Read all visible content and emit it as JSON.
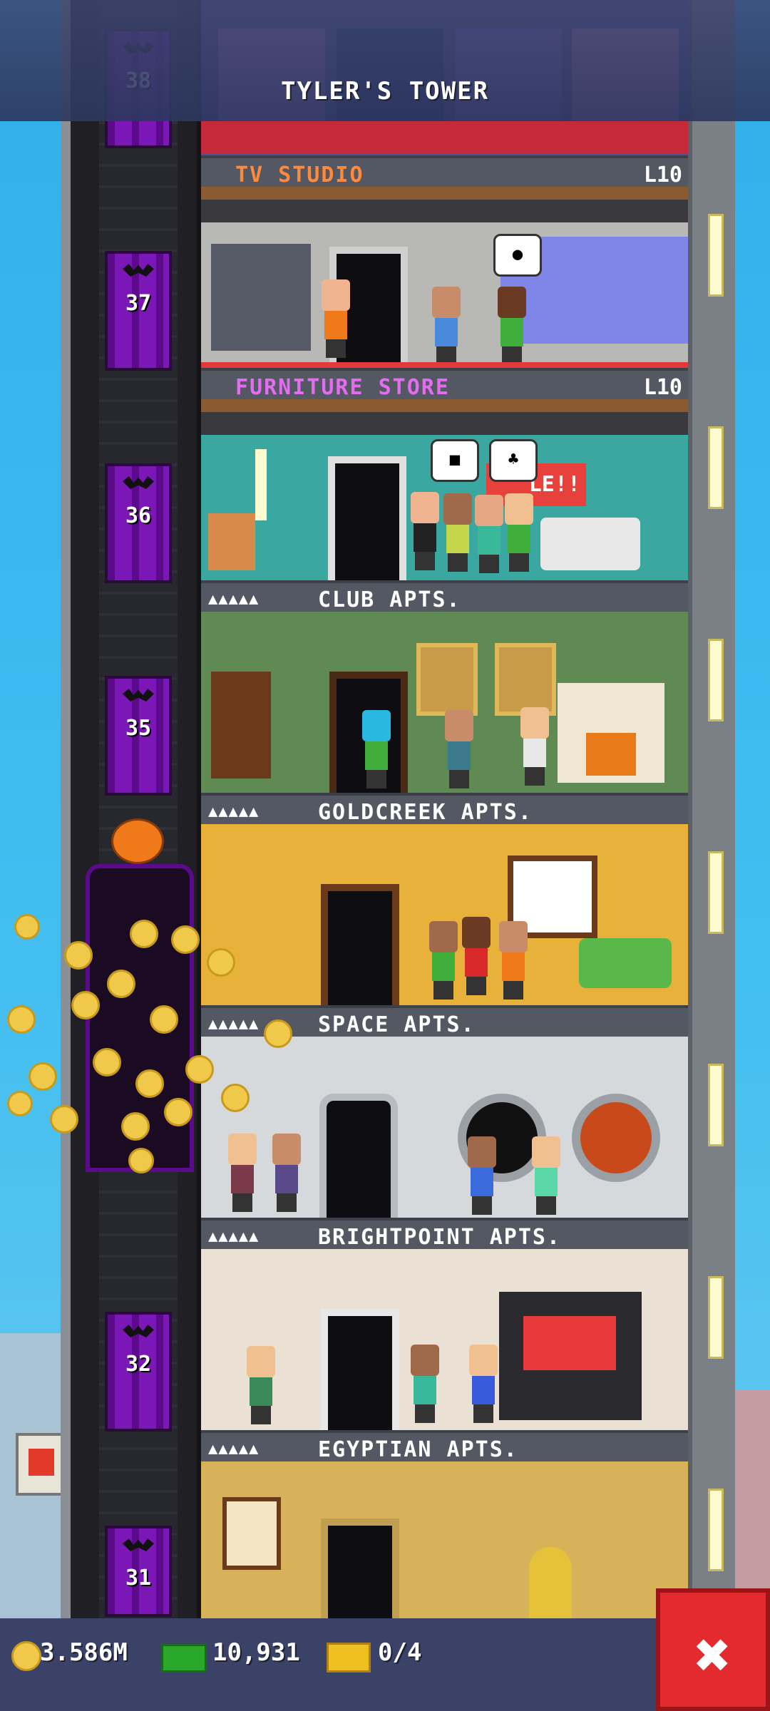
{
  "header": {
    "title": "TYLER'S TOWER"
  },
  "shaft": {
    "floor_numbers": [
      "38",
      "37",
      "36",
      "35",
      "32",
      "31"
    ]
  },
  "floors": [
    {
      "name": "TV STUDIO",
      "level": "L10",
      "kind": "business",
      "name_color": "#ff8a3c"
    },
    {
      "name": "FURNITURE STORE",
      "level": "L10",
      "kind": "business",
      "name_color": "#e46cf0",
      "sign": "LE!!"
    },
    {
      "name": "CLUB APTS.",
      "stars": "▲▲▲▲▲",
      "kind": "apartment"
    },
    {
      "name": "GOLDCREEK APTS.",
      "stars": "▲▲▲▲▲",
      "kind": "apartment"
    },
    {
      "name": "SPACE APTS.",
      "stars": "▲▲▲▲▲",
      "kind": "apartment"
    },
    {
      "name": "BRIGHTPOINT APTS.",
      "stars": "▲▲▲▲▲",
      "kind": "apartment"
    },
    {
      "name": "EGYPTIAN APTS.",
      "stars": "▲▲▲▲▲",
      "kind": "apartment"
    }
  ],
  "footer": {
    "coins": "3.586M",
    "bux": "10,931",
    "tickets": "0/4"
  },
  "close_button": {
    "label": "✖"
  },
  "icons": [
    "coin-icon",
    "bux-icon",
    "ticket-icon",
    "close-icon",
    "pumpkin-icon",
    "bat-icon"
  ]
}
